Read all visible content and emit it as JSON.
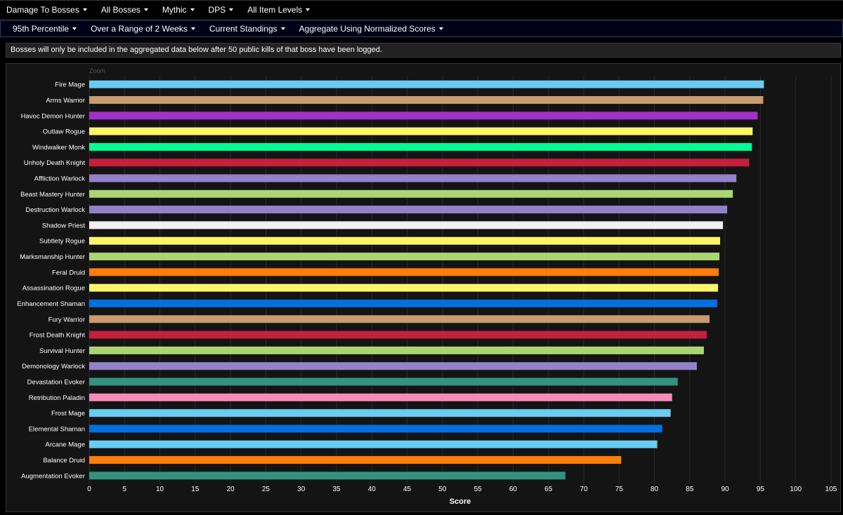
{
  "filters_row1": [
    {
      "label": "Damage To Bosses"
    },
    {
      "label": "All Bosses"
    },
    {
      "label": "Mythic"
    },
    {
      "label": "DPS"
    },
    {
      "label": "All Item Levels"
    }
  ],
  "filters_row2": [
    {
      "label": "95th Percentile"
    },
    {
      "label": "Over a Range of 2 Weeks"
    },
    {
      "label": "Current Standings"
    },
    {
      "label": "Aggregate Using Normalized Scores"
    }
  ],
  "notice": "Bosses will only be included in the aggregated data below after 50 public kills of that boss have been logged.",
  "zoom_label": "Zoom",
  "chart_data": {
    "type": "bar",
    "orientation": "horizontal",
    "xlabel": "Score",
    "xlim": [
      0,
      105
    ],
    "xticks": [
      0,
      5,
      10,
      15,
      20,
      25,
      30,
      35,
      40,
      45,
      50,
      55,
      60,
      65,
      70,
      75,
      80,
      85,
      90,
      95,
      100,
      105
    ],
    "grid": true,
    "categories": [
      "Fire Mage",
      "Arms Warrior",
      "Havoc Demon Hunter",
      "Outlaw Rogue",
      "Windwalker Monk",
      "Unholy Death Knight",
      "Affliction Warlock",
      "Beast Mastery Hunter",
      "Destruction Warlock",
      "Shadow Priest",
      "Subtlety Rogue",
      "Marksmanship Hunter",
      "Feral Druid",
      "Assassination Rogue",
      "Enhancement Shaman",
      "Fury Warrior",
      "Frost Death Knight",
      "Survival Hunter",
      "Demonology Warlock",
      "Devastation Evoker",
      "Retribution Paladin",
      "Frost Mage",
      "Elemental Shaman",
      "Arcane Mage",
      "Balance Druid",
      "Augmentation Evoker"
    ],
    "values": [
      95.5,
      95.4,
      94.6,
      93.9,
      93.8,
      93.4,
      91.6,
      91.1,
      90.3,
      89.7,
      89.3,
      89.2,
      89.1,
      89.0,
      88.9,
      87.8,
      87.4,
      87.0,
      86.0,
      83.3,
      82.5,
      82.3,
      81.1,
      80.4,
      75.3,
      67.4
    ],
    "colors": [
      "#69CCF0",
      "#C79C6E",
      "#A330C9",
      "#FFF569",
      "#00FF96",
      "#C41F3B",
      "#9482C9",
      "#ABD473",
      "#9482C9",
      "#F0F0F0",
      "#FFF569",
      "#ABD473",
      "#FF7D0A",
      "#FFF569",
      "#0070DE",
      "#C79C6E",
      "#C41F3B",
      "#ABD473",
      "#9482C9",
      "#33937F",
      "#F58CBA",
      "#69CCF0",
      "#0070DE",
      "#69CCF0",
      "#FF7D0A",
      "#33937F"
    ]
  }
}
